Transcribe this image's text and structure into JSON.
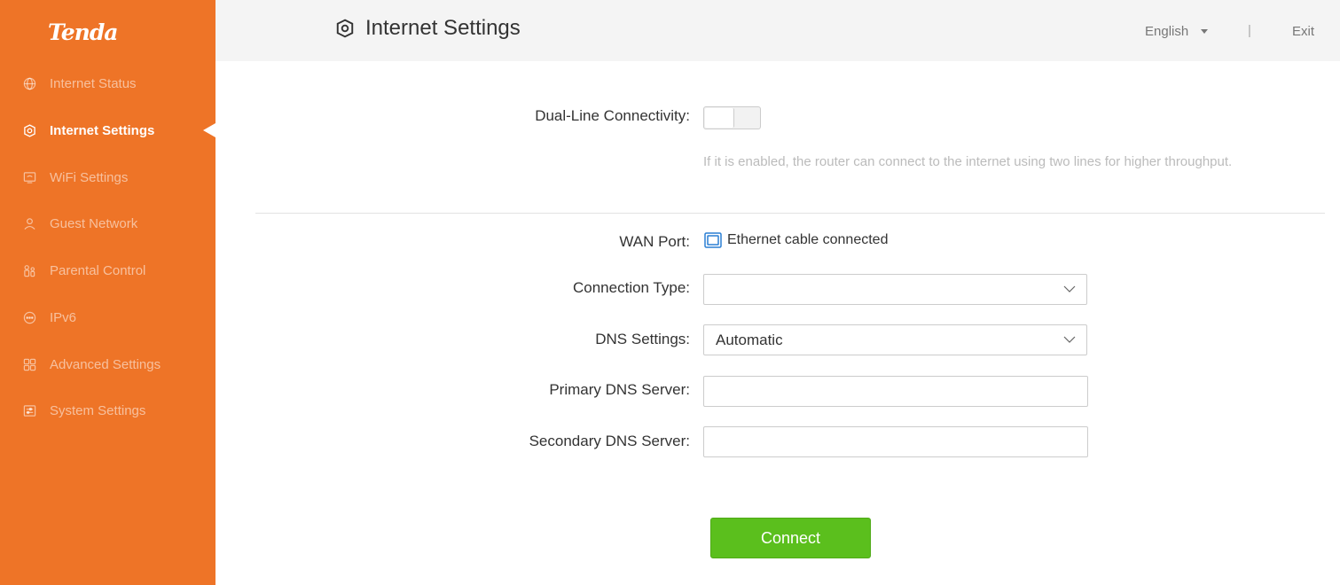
{
  "app": {
    "logo": "Tenda",
    "accent_color": "#ee7427",
    "button_color": "#5bbf1d"
  },
  "header": {
    "title": "Internet Settings",
    "title_icon": "internet-settings-icon",
    "language": "English",
    "separator": "|",
    "exit": "Exit"
  },
  "sidebar": {
    "items": [
      {
        "label": "Internet Status",
        "icon": "globe-icon",
        "active": false
      },
      {
        "label": "Internet Settings",
        "icon": "internet-settings-icon",
        "active": true
      },
      {
        "label": "WiFi Settings",
        "icon": "wifi-settings-icon",
        "active": false
      },
      {
        "label": "Guest Network",
        "icon": "guest-user-icon",
        "active": false
      },
      {
        "label": "Parental Control",
        "icon": "parental-control-icon",
        "active": false
      },
      {
        "label": "IPv6",
        "icon": "ipv6-icon",
        "active": false
      },
      {
        "label": "Advanced Settings",
        "icon": "grid-icon",
        "active": false
      },
      {
        "label": "System Settings",
        "icon": "system-settings-icon",
        "active": false
      }
    ]
  },
  "form": {
    "dual_line": {
      "label": "Dual-Line Connectivity:",
      "enabled": false,
      "hint": "If it is enabled, the router can connect to the internet using two lines for higher throughput."
    },
    "wan_port": {
      "label": "WAN Port:",
      "status": "Ethernet cable connected",
      "icon": "ethernet-port-icon"
    },
    "connection_type": {
      "label": "Connection Type:",
      "value": ""
    },
    "dns_settings": {
      "label": "DNS Settings:",
      "value": "Automatic"
    },
    "primary_dns": {
      "label": "Primary DNS Server:",
      "value": ""
    },
    "secondary_dns": {
      "label": "Secondary DNS Server:",
      "value": ""
    },
    "connect_button": "Connect"
  }
}
